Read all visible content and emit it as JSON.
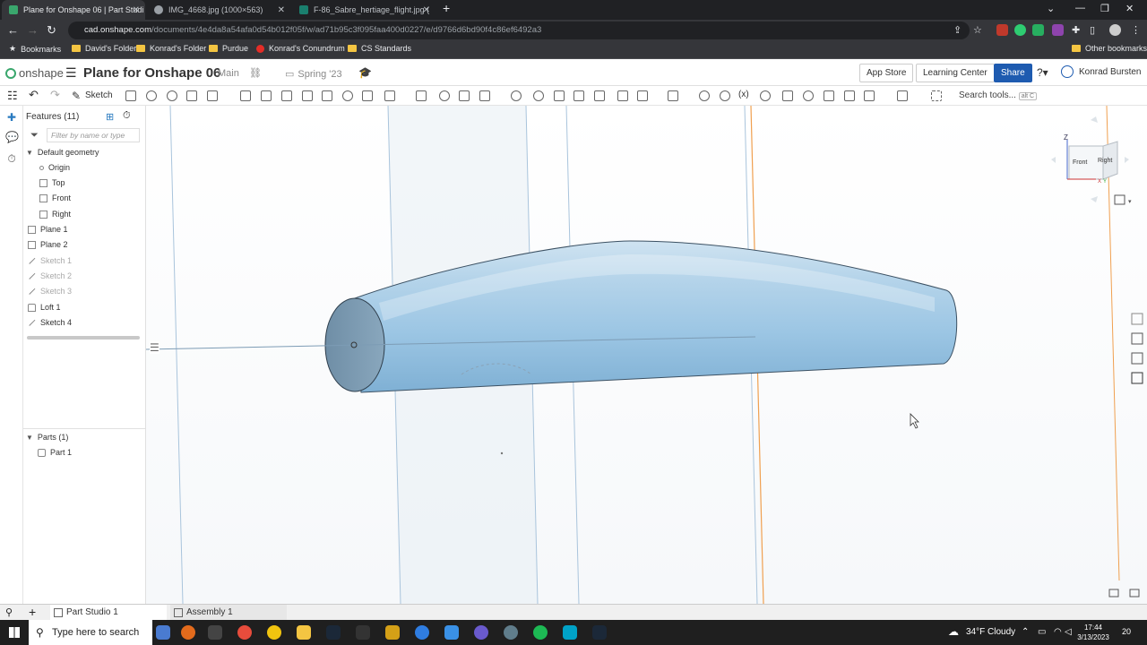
{
  "browser": {
    "tabs": [
      {
        "title": "Plane for Onshape 06 | Part Studi",
        "active": true
      },
      {
        "title": "IMG_4668.jpg (1000×563)",
        "active": false
      },
      {
        "title": "F-86_Sabre_hertiage_flight.jpg (",
        "active": false
      }
    ],
    "new_tab": "+",
    "url_host": "cad.onshape.com",
    "url_path": "/documents/4e4da8a54afa0d54b012f05f/w/ad71b95c3f095faa400d0227/e/d9766d6bd90f4c86ef6492a3",
    "bookmarks": [
      "Bookmarks",
      "David's Folder",
      "Konrad's Folder",
      "Purdue",
      "Konrad's Conundrum",
      "CS Standards"
    ],
    "other_bookmarks": "Other bookmarks"
  },
  "header": {
    "logo_text": "onshape",
    "doc_title": "Plane for Onshape 06",
    "branch": "Main",
    "folder": "Spring '23",
    "app_store": "App Store",
    "learning_center": "Learning Center",
    "share": "Share",
    "user": "Konrad Bursten"
  },
  "toolbar": {
    "sketch": "Sketch",
    "search_tools": "Search tools...",
    "search_shortcut": "alt C"
  },
  "features": {
    "title": "Features (11)",
    "filter_placeholder": "Filter by name or type",
    "default_geometry": "Default geometry",
    "items": [
      {
        "label": "Origin",
        "icon": "origin-icon"
      },
      {
        "label": "Top",
        "icon": "plane-icon"
      },
      {
        "label": "Front",
        "icon": "plane-icon"
      },
      {
        "label": "Right",
        "icon": "plane-icon"
      },
      {
        "label": "Plane 1",
        "icon": "plane-icon"
      },
      {
        "label": "Plane 2",
        "icon": "plane-icon"
      },
      {
        "label": "Sketch 1",
        "icon": "sketch-icon"
      },
      {
        "label": "Sketch 2",
        "icon": "sketch-icon"
      },
      {
        "label": "Sketch 3",
        "icon": "sketch-icon"
      },
      {
        "label": "Loft 1",
        "icon": "loft-icon"
      },
      {
        "label": "Sketch 4",
        "icon": "sketch-icon"
      }
    ],
    "parts_title": "Parts (1)",
    "parts": [
      "Part 1"
    ]
  },
  "viewcube": {
    "top": "Z",
    "front": "Front",
    "right": "Right",
    "x": "X",
    "y": "Y"
  },
  "bottom_tabs": {
    "add": "+",
    "part_studio": "Part Studio 1",
    "assembly": "Assembly 1"
  },
  "taskbar": {
    "search": "Type here to search",
    "weather": "34°F  Cloudy",
    "time": "17:44",
    "date": "3/13/2023",
    "notifications": "20"
  },
  "colors": {
    "onshape_green": "#3aa76d",
    "share_blue": "#1e5bb0",
    "part_blue": "#9cc6e4",
    "plane_line": "#a9c4dc",
    "orange_plane": "#f0a050"
  }
}
